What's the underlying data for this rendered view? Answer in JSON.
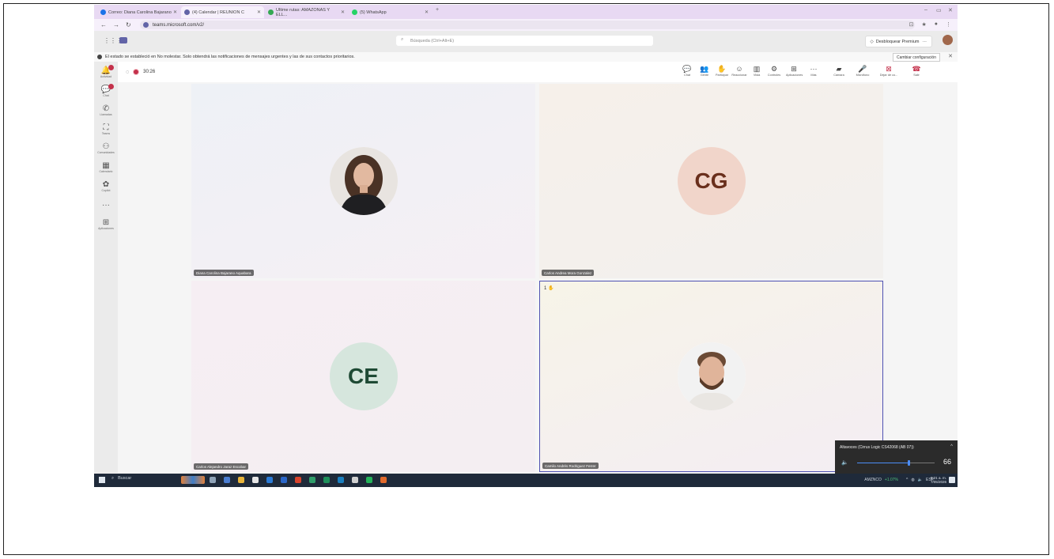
{
  "browser": {
    "tabs": [
      {
        "label": "Correo: Diana Carolina Bajarano",
        "active": false,
        "fav_color": "#1a73e8"
      },
      {
        "label": "(4) Calendar | REUNION C",
        "active": true,
        "fav_color": "#6264a7"
      },
      {
        "label": "Ultime rutas: AMAZONAS Y ELL...",
        "active": false,
        "fav_color": "#34a853"
      },
      {
        "label": "(5) WhatsApp",
        "active": false,
        "fav_color": "#25d366"
      }
    ],
    "new_tab": "+",
    "url": "teams.microsoft.com/v2/"
  },
  "teams": {
    "search_placeholder": "Búsqueda (Ctrl+Alt+E)",
    "premium_label": "Desbloquear Premium",
    "more": "···"
  },
  "banner": {
    "text": "El estado se estableció en No molestar. Solo obtendrá las notificaciones de mensajes urgentes y las de sus contactos prioritarios.",
    "change_label": "Cambiar configuración",
    "close": "✕"
  },
  "rail": [
    {
      "label": "Actividad",
      "icon": "bell-icon",
      "badge": true
    },
    {
      "label": "Chat",
      "icon": "chat-icon",
      "badge": true
    },
    {
      "label": "Llamadas",
      "icon": "phone-icon",
      "badge": false
    },
    {
      "label": "Teams",
      "icon": "teams-icon",
      "badge": false
    },
    {
      "label": "Comunidades",
      "icon": "community-icon",
      "badge": false
    },
    {
      "label": "Calendario",
      "icon": "calendar-icon",
      "badge": false
    },
    {
      "label": "Copilot",
      "icon": "copilot-icon",
      "badge": false
    },
    {
      "label": "···",
      "icon": "more-icon",
      "badge": false
    },
    {
      "label": "Aplicaciones",
      "icon": "apps-icon",
      "badge": false
    }
  ],
  "meeting": {
    "timer": "30:26",
    "toolbar": [
      {
        "label": "Chat",
        "icon": "chat-icon",
        "glyph": "💬"
      },
      {
        "label": "Gente",
        "icon": "people-icon",
        "glyph": "👥"
      },
      {
        "label": "Participar",
        "icon": "raise-hand-icon",
        "glyph": "✋"
      },
      {
        "label": "Reaccionar",
        "icon": "react-icon",
        "glyph": "☺"
      },
      {
        "label": "Vista",
        "icon": "view-icon",
        "glyph": "▥"
      },
      {
        "label": "Controles",
        "icon": "controls-icon",
        "glyph": "⚙"
      },
      {
        "label": "Aplicaciones",
        "icon": "apps-icon",
        "glyph": "⊞"
      },
      {
        "label": "Más",
        "icon": "more-icon",
        "glyph": "···"
      },
      {
        "label": "Cámara",
        "icon": "camera-icon",
        "glyph": "▰"
      },
      {
        "label": "Micrófono",
        "icon": "mic-icon",
        "glyph": "🎤"
      },
      {
        "label": "Dejar de co...",
        "icon": "stop-share-icon",
        "glyph": "⊠"
      },
      {
        "label": "Salir",
        "icon": "leave-icon",
        "glyph": "☎"
      }
    ],
    "participants": [
      {
        "name": "Diana Carolina Bajarano Aquabara",
        "initials": "",
        "type": "photo-woman"
      },
      {
        "name": "Carlos Andrea Mora Gonzalez",
        "initials": "CG",
        "type": "initials"
      },
      {
        "name": "Carlos Alejandro Jaraz Escobar",
        "initials": "CE",
        "type": "initials"
      },
      {
        "name": "Camilo Andrés Rodriguez Ferrer",
        "initials": "",
        "type": "photo-man",
        "hand_count": "1"
      }
    ]
  },
  "volume": {
    "device": "Altavoces (Cirrus Logic CS42068 (AB 07))",
    "value": "66",
    "level": 0.66
  },
  "taskbar": {
    "search": "Buscar",
    "stock_label": "AMZNCO",
    "stock_change": "+1.07%",
    "lang": "ESP",
    "time": "8:21 a. m.",
    "date": "7/05/2026"
  }
}
